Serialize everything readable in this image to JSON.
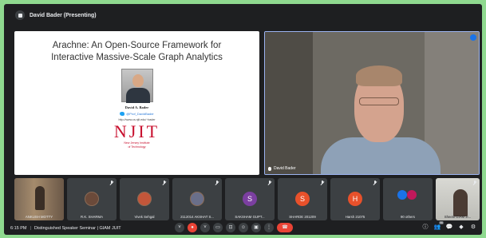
{
  "topbar": {
    "presenting_label": "David Bader (Presenting)"
  },
  "slide": {
    "title_line1": "Arachne: An Open-Source Framework for",
    "title_line2": "Interactive Massive-Scale Graph Analytics",
    "author": "David A. Bader",
    "twitter": "@Prof_DavidBader",
    "url": "http://www.cs.njit.edu/~bader",
    "logo": "NJIT",
    "institute_line1": "New Jersey Institute",
    "institute_line2": "of Technology"
  },
  "main_video": {
    "name": "David Bader"
  },
  "participants": [
    {
      "name": "ANKUSH MOTTY",
      "kind": "photo",
      "muted": false
    },
    {
      "name": "R.K. SHARMA",
      "kind": "photo-avatar",
      "muted": true
    },
    {
      "name": "Vivek Sehgal",
      "kind": "photo-avatar",
      "muted": true
    },
    {
      "name": "2112014 AKSHAT S...",
      "kind": "photo-avatar",
      "muted": true
    },
    {
      "name": "SAKSHAM GUPT...",
      "kind": "letter",
      "letter": "S",
      "color": "#7b3fa0",
      "muted": true
    },
    {
      "name": "SHARDE 201209",
      "kind": "letter",
      "letter": "S",
      "color": "#e8512b",
      "muted": true
    },
    {
      "name": "Harsh 21075",
      "kind": "letter",
      "letter": "H",
      "color": "#e8512b",
      "muted": true
    },
    {
      "name": "90 others",
      "kind": "others",
      "muted": false
    },
    {
      "name": "Sheetil GIAM JI...",
      "kind": "self",
      "muted": true
    }
  ],
  "bottombar": {
    "time": "6:15 PM",
    "separator": "|",
    "meeting_title": "Distinguished Speaker Seminar | GIAM JUIT",
    "controls": [
      "˅",
      "●",
      "˅",
      "▭",
      "⊡",
      "☺",
      "▣",
      "⋮"
    ],
    "leave_icon": "☎",
    "right_controls": [
      "ⓘ",
      "👥",
      "💬",
      "◆",
      "⚙"
    ],
    "people_badge": "96"
  },
  "colors": {
    "outer_border": "#8fd98f",
    "background": "#1e1f21",
    "tile": "#3c4043",
    "red": "#ea4335",
    "njit_red": "#c8102e"
  }
}
